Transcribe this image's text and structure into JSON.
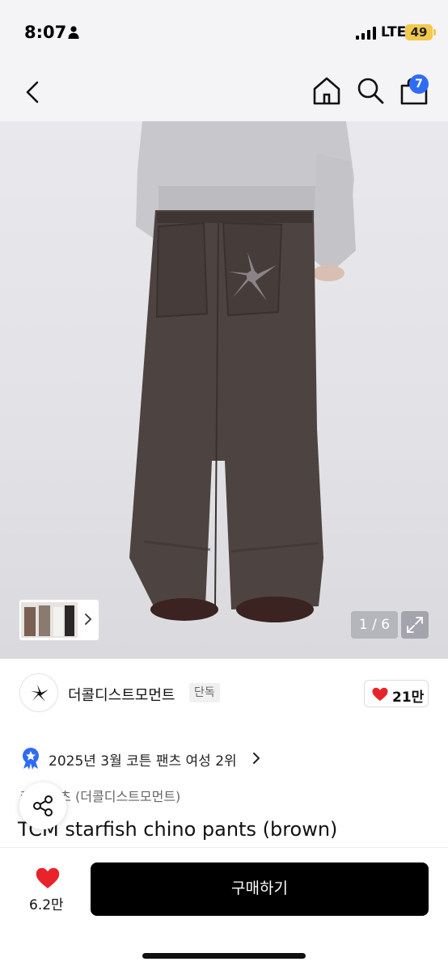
{
  "status_bar": {
    "time": "8:07",
    "network": "LTE",
    "battery": "49"
  },
  "nav": {
    "cart_count": "7",
    "icons": [
      "back-icon",
      "home-icon",
      "search-icon",
      "cart-icon"
    ]
  },
  "gallery": {
    "counter": "1 / 6",
    "icons": [
      "chevron-right-icon",
      "expand-icon"
    ]
  },
  "brand": {
    "name": "더콜디스트모먼트",
    "badge": "단독",
    "likes": "21만"
  },
  "ranking": {
    "text": "2025년 3월 코튼 팬츠 여성 2위"
  },
  "product": {
    "category": "코튼 팬츠 (더콜디스트모먼트)",
    "title": "TCM starfish chino pants (brown)"
  },
  "bottom_bar": {
    "wish_count": "6.2만",
    "buy_label": "구매하기"
  },
  "colors": {
    "accent_blue": "#2f6cf6",
    "heart_red": "#e8242a",
    "buy_button": "#000000"
  }
}
